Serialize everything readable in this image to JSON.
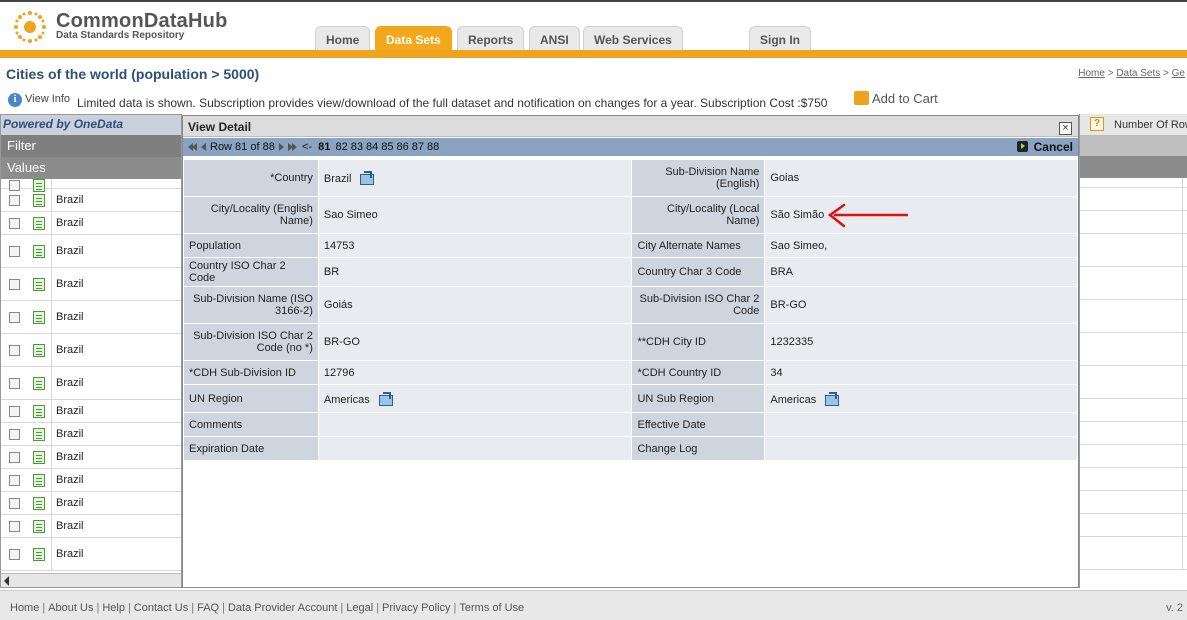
{
  "brand": {
    "title": "CommonDataHub",
    "subtitle": "Data Standards Repository"
  },
  "nav": {
    "tabs": [
      "Home",
      "Data Sets",
      "Reports",
      "ANSI",
      "Web Services",
      "Sign In"
    ],
    "active": "Data Sets"
  },
  "page": {
    "title": "Cities of the world (population > 5000)",
    "breadcrumb": [
      "Home",
      "Data Sets",
      "Ge"
    ],
    "view_info": "View Info",
    "limited_text": "Limited data is shown. Subscription provides view/download of the full dataset and notification on changes for a year. Subscription Cost :$750",
    "add_to_cart": "Add to Cart"
  },
  "left_panel": {
    "powered_by": "Powered by OneData",
    "filter": "Filter",
    "values": "Values",
    "rows": [
      "",
      "Brazil",
      "Brazil",
      "Brazil",
      "Brazil",
      "Brazil",
      "Brazil",
      "Brazil",
      "Brazil",
      "Brazil",
      "Brazil",
      "Brazil",
      "Brazil",
      "Brazil",
      "Brazil"
    ]
  },
  "right_panel": {
    "rows_label": "Number Of Rows"
  },
  "modal": {
    "title": "View Detail",
    "row_label": "Row 81 of 88",
    "prev_marker": "<-",
    "current_page": "81",
    "pages": [
      "82",
      "83",
      "84",
      "85",
      "86",
      "87",
      "88"
    ],
    "cancel": "Cancel",
    "fields": [
      {
        "l1": "*Country",
        "v1": "Brazil",
        "i1": true,
        "l2": "Sub-Division Name (English)",
        "v2": "Goias",
        "i2": false
      },
      {
        "l1": "City/Locality (English Name)",
        "v1": "Sao Simeo",
        "i1": false,
        "l2": "City/Locality (Local Name)",
        "v2": "São Simão",
        "i2": false
      },
      {
        "l1": "Population",
        "v1": "14753",
        "i1": false,
        "l2": "City Alternate Names",
        "v2": "Sao Simeo,",
        "i2": false
      },
      {
        "l1": "Country ISO Char 2 Code",
        "v1": "BR",
        "i1": false,
        "l2": "Country Char 3 Code",
        "v2": "BRA",
        "i2": false
      },
      {
        "l1": "Sub-Division Name (ISO 3166-2)",
        "v1": "Goiás",
        "i1": false,
        "l2": "Sub-Division ISO Char 2 Code",
        "v2": "BR-GO",
        "i2": false
      },
      {
        "l1": "Sub-Division ISO Char 2 Code (no *)",
        "v1": "BR-GO",
        "i1": false,
        "l2": "**CDH City ID",
        "v2": "1232335",
        "i2": false
      },
      {
        "l1": "*CDH Sub-Division ID",
        "v1": "12796",
        "i1": false,
        "l2": "*CDH Country ID",
        "v2": "34",
        "i2": false
      },
      {
        "l1": "UN Region",
        "v1": "Americas",
        "i1": true,
        "l2": "UN Sub Region",
        "v2": "Americas",
        "i2": true
      },
      {
        "l1": "Comments",
        "v1": "",
        "i1": false,
        "l2": "Effective Date",
        "v2": "",
        "i2": false
      },
      {
        "l1": "Expiration Date",
        "v1": "",
        "i1": false,
        "l2": "Change Log",
        "v2": "",
        "i2": false
      }
    ]
  },
  "footer": {
    "links": [
      "Home",
      "About Us",
      "Help",
      "Contact Us",
      "FAQ",
      "Data Provider Account",
      "Legal",
      "Privacy Policy",
      "Terms of Use"
    ],
    "version": "v. 2"
  },
  "colors": {
    "accent": "#f0a31c",
    "title_blue": "#2e4f7a",
    "nav_row": "#8aa3c1",
    "annotation_red": "#e01010"
  }
}
